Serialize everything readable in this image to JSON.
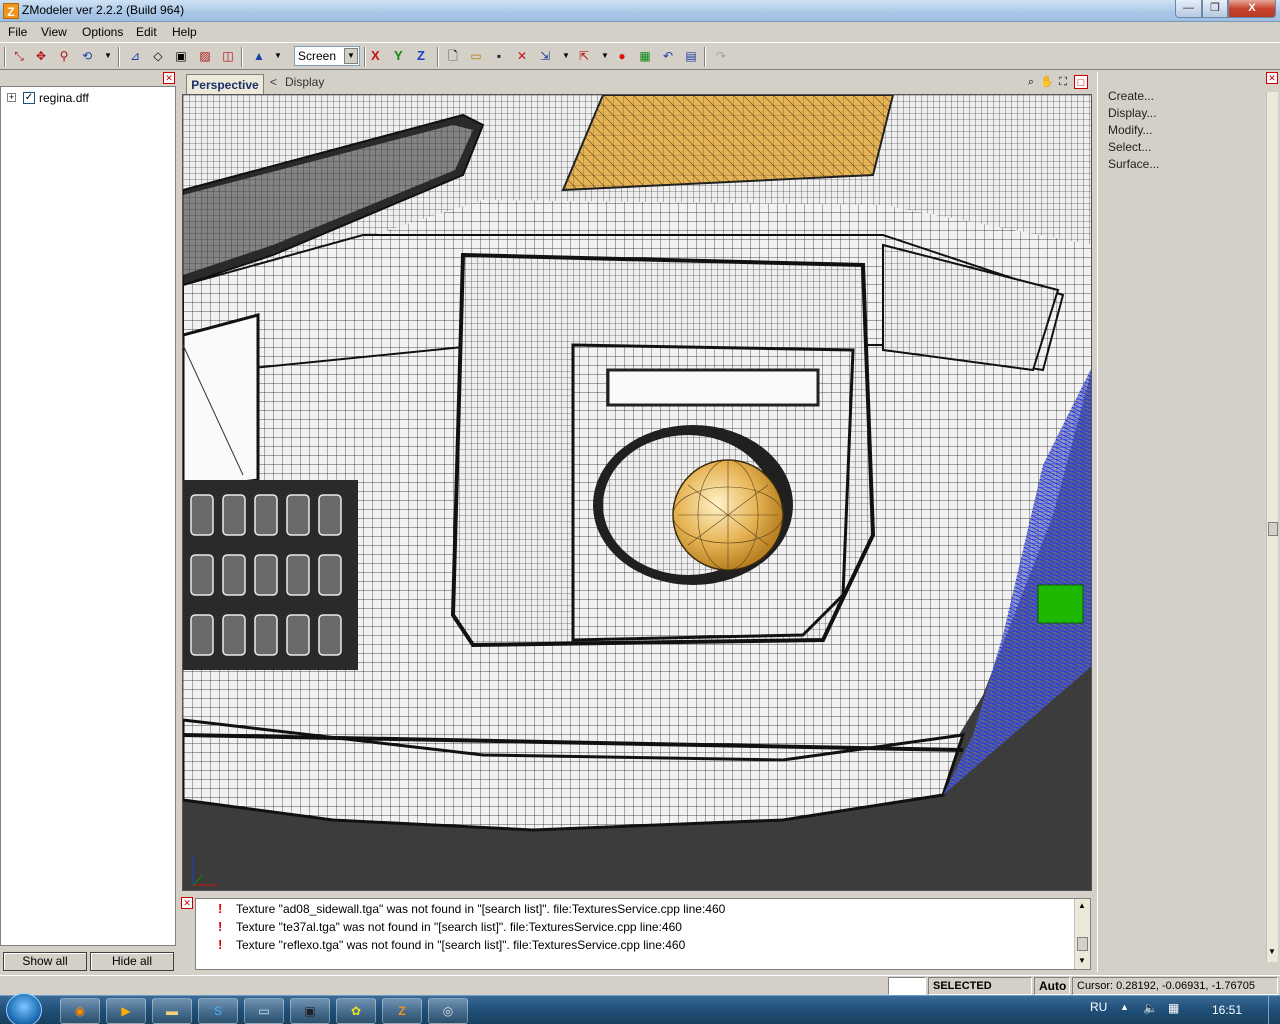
{
  "window": {
    "title": "ZModeler ver 2.2.2 (Build 964)",
    "app_icon_letter": "Z",
    "min_label": "—",
    "max_label": "❐",
    "close_label": "X"
  },
  "menu": {
    "items": [
      "File",
      "View",
      "Options",
      "Edit",
      "Help"
    ]
  },
  "toolbar": {
    "view_mode_value": "Screen",
    "axis_x": "X",
    "axis_y": "Y",
    "axis_z": "Z"
  },
  "scene_tree": {
    "file_name": "regina.dff",
    "expander": "+",
    "checked": "✓"
  },
  "left_buttons": {
    "show_all": "Show all",
    "hide_all": "Hide all"
  },
  "viewport": {
    "tab_label": "Perspective",
    "display_arrow": "<",
    "display_label": "Display"
  },
  "log": {
    "lines": [
      "Texture \"ad08_sidewall.tga\" was not found in \"[search list]\". file:TexturesService.cpp line:460",
      "Texture \"te37al.tga\" was not found in \"[search list]\". file:TexturesService.cpp line:460",
      "Texture \"reflexo.tga\" was not found in \"[search list]\". file:TexturesService.cpp line:460"
    ],
    "marker": "!"
  },
  "commands": {
    "items": [
      "Create...",
      "Display...",
      "Modify...",
      "Select...",
      "Surface..."
    ]
  },
  "status": {
    "mode": "SELECTED MODE",
    "auto": "Auto",
    "cursor": "Cursor: 0.28192, -0.06931, -1.76705"
  },
  "taskbar": {
    "lang": "RU",
    "time": "16:51"
  },
  "colors": {
    "mesh_fill": "#f2f2f2",
    "mesh_line": "#1a1a1a",
    "lamp_gold": "#e6b455",
    "selection_blue": "#1a2cff",
    "gizmo_green": "#1fb800"
  }
}
